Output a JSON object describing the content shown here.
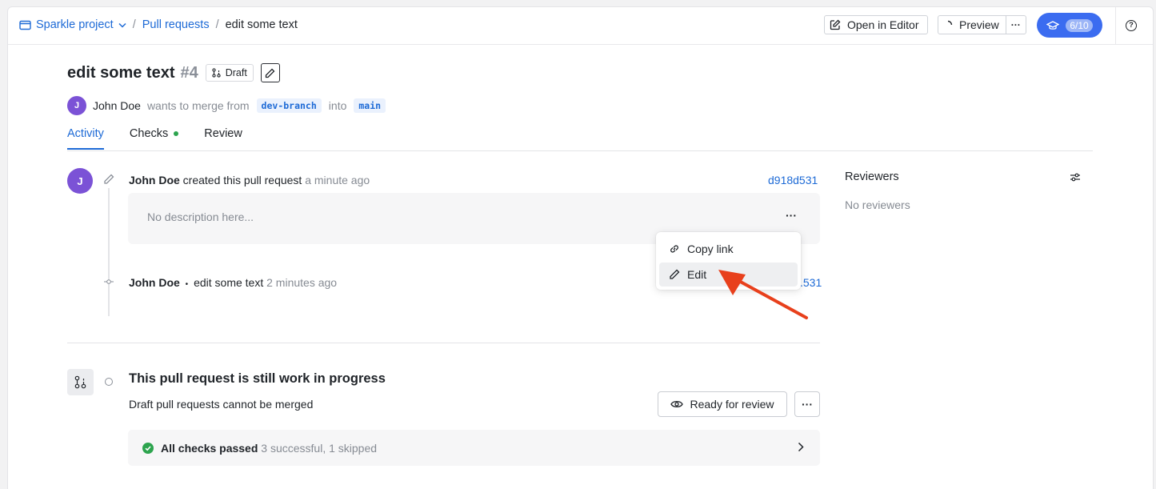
{
  "breadcrumb": {
    "project": "Sparkle project",
    "section": "Pull requests",
    "current": "edit some text"
  },
  "toolbar": {
    "open_editor": "Open in Editor",
    "preview": "Preview",
    "more": "···",
    "progress_badge": "6/10"
  },
  "pr": {
    "title": "edit some text",
    "number": "#4",
    "status": "Draft",
    "author": "John Doe",
    "author_initial": "J",
    "merge_text": "wants to merge from",
    "source_branch": "dev-branch",
    "into_text": "into",
    "target_branch": "main"
  },
  "tabs": [
    {
      "label": "Activity",
      "active": true
    },
    {
      "label": "Checks",
      "status_color": "#2da44e"
    },
    {
      "label": "Review"
    }
  ],
  "activity": {
    "event1": {
      "author": "John Doe",
      "action": "created this pull request",
      "time": "a minute ago",
      "hash": "d918d531",
      "description_placeholder": "No description here...",
      "more": "···"
    },
    "event2": {
      "author": "John Doe",
      "bullet": "•",
      "message": "edit some text",
      "time": "2 minutes ago",
      "hash_partial": ".531"
    }
  },
  "context_menu": {
    "items": [
      {
        "label": "Copy link",
        "icon": "link-icon"
      },
      {
        "label": "Edit",
        "icon": "pencil-icon",
        "hovered": true
      }
    ]
  },
  "merge_box": {
    "title": "This pull request is still work in progress",
    "subtitle": "Draft pull requests cannot be merged",
    "ready_button": "Ready for review",
    "more": "···",
    "checks_title": "All checks passed",
    "checks_detail": "3 successful, 1 skipped"
  },
  "sidebar": {
    "reviewers_title": "Reviewers",
    "reviewers_empty": "No reviewers"
  },
  "colors": {
    "accent": "#1d6ad6",
    "badge": "#3b6cf0",
    "avatar": "#7b52d6",
    "success": "#2da44e",
    "annotation_arrow": "#e8401c"
  }
}
